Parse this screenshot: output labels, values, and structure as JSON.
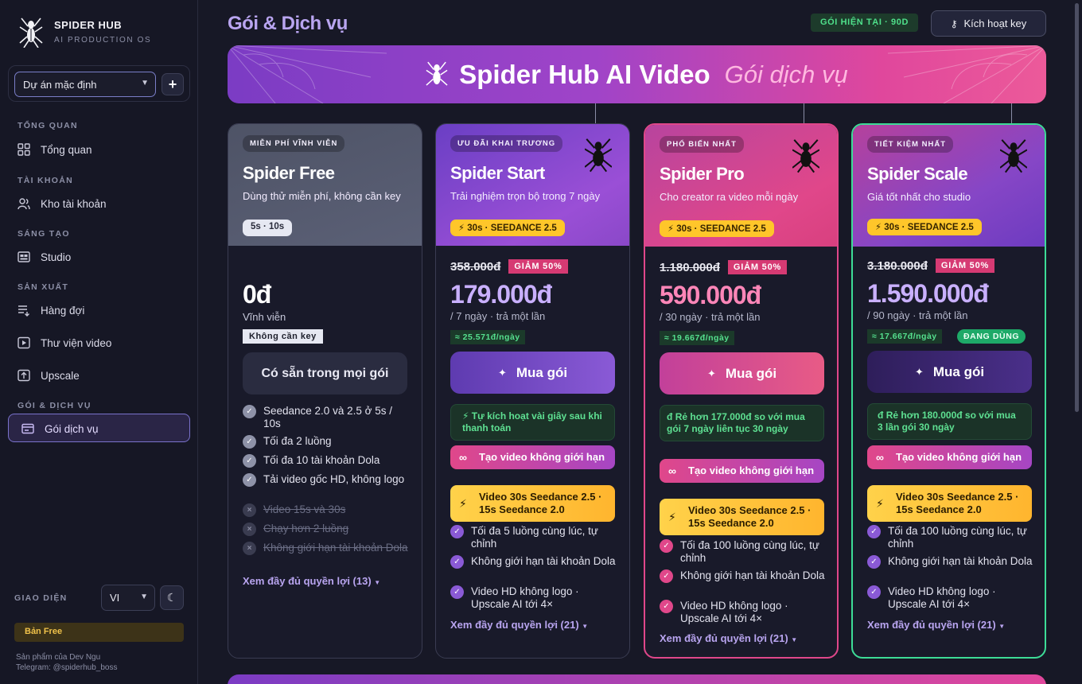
{
  "brand": {
    "name": "SPIDER HUB",
    "sub": "AI PRODUCTION OS"
  },
  "project": {
    "selected": "Dự án mặc định",
    "add": "+"
  },
  "nav": {
    "sections": [
      "TỔNG QUAN",
      "TÀI KHOẢN",
      "SÁNG TẠO",
      "SẢN XUẤT",
      "GÓI & DỊCH VỤ"
    ],
    "items": [
      "Tổng quan",
      "Kho tài khoản",
      "Studio",
      "Hàng đợi",
      "Thư viện video",
      "Upscale",
      "Gói dịch vụ"
    ]
  },
  "footer": {
    "giao_dien": "GIAO DIỆN",
    "lang": "VI",
    "plan_badge": "Bản Free",
    "credit1": "Sản phẩm của Dev Ngu",
    "credit2": "Telegram: @spiderhub_boss"
  },
  "header": {
    "title": "Gói & Dịch vụ",
    "current_plan": "GÓI HIỆN TẠI · 90D",
    "activate": "Kích hoạt key"
  },
  "banner": {
    "title": "Spider Hub AI Video",
    "subtitle": "Gói dịch vụ"
  },
  "colors": {
    "accent": "#b9a5f0",
    "pro": "#e0478a",
    "scale": "#3ddc97"
  },
  "plans": [
    {
      "tag": "MIỄN PHÍ VĨNH VIỄN",
      "name": "Spider Free",
      "desc": "Dùng thử miễn phí, không cần key",
      "chip": "5s · 10s",
      "price": "0đ",
      "per": "Vĩnh viễn",
      "nokey": "Không cần key",
      "avail": "Có sẵn trong mọi gói",
      "list": [
        "Seedance 2.0 và 2.5 ở 5s / 10s",
        "Tối đa 2 luồng",
        "Tối đa 10 tài khoản Dola",
        "Tải video gốc HD, không logo",
        "Video 15s và 30s",
        "Chạy hơn 2 luồng",
        "Không giới hạn tài khoản Dola"
      ],
      "more": "Xem đầy đủ quyền lợi (13)"
    },
    {
      "tag": "ƯU ĐÃI KHAI TRƯƠNG",
      "name": "Spider Start",
      "desc": "Trải nghiệm trọn bộ trong 7 ngày",
      "chip": "30s · SEEDANCE 2.5",
      "old": "358.000đ",
      "disc": "GIẢM 50%",
      "price": "179.000đ",
      "per": "/ 7 ngày · trả một lần",
      "perday": "≈ 25.571đ/ngày",
      "buy": "Mua gói",
      "note": "Tự kích hoạt vài giây sau khi thanh toán",
      "f1": "Tạo video không giới hạn",
      "f2": "Video 30s Seedance 2.5 · 15s Seedance 2.0",
      "list": [
        "Tối đa 5 luồng cùng lúc, tự chỉnh",
        "Không giới hạn tài khoản Dola",
        "Video HD không logo · Upscale AI tới 4×"
      ],
      "more": "Xem đầy đủ quyền lợi (21)"
    },
    {
      "tag": "PHỔ BIẾN NHẤT",
      "name": "Spider Pro",
      "desc": "Cho creator ra video mỗi ngày",
      "chip": "30s · SEEDANCE 2.5",
      "old": "1.180.000đ",
      "disc": "GIẢM 50%",
      "price": "590.000đ",
      "per": "/ 30 ngày · trả một lần",
      "perday": "≈ 19.667đ/ngày",
      "buy": "Mua gói",
      "note": "Rẻ hơn 177.000đ so với mua gói 7 ngày liên tục 30 ngày",
      "f1": "Tạo video không giới hạn",
      "f2": "Video 30s Seedance 2.5 · 15s Seedance 2.0",
      "list": [
        "Tối đa 100 luồng cùng lúc, tự chỉnh",
        "Không giới hạn tài khoản Dola",
        "Video HD không logo · Upscale AI tới 4×"
      ],
      "more": "Xem đầy đủ quyền lợi (21)"
    },
    {
      "tag": "TIẾT KIỆM NHẤT",
      "name": "Spider Scale",
      "desc": "Giá tốt nhất cho studio",
      "chip": "30s · SEEDANCE 2.5",
      "old": "3.180.000đ",
      "disc": "GIẢM 50%",
      "price": "1.590.000đ",
      "per": "/ 90 ngày · trả một lần",
      "perday": "≈ 17.667đ/ngày",
      "using": "ĐANG DÙNG",
      "buy": "Mua gói",
      "note": "Rẻ hơn 180.000đ so với mua 3 lần gói 30 ngày",
      "f1": "Tạo video không giới hạn",
      "f2": "Video 30s Seedance 2.5 · 15s Seedance 2.0",
      "list": [
        "Tối đa 100 luồng cùng lúc, tự chỉnh",
        "Không giới hạn tài khoản Dola",
        "Video HD không logo · Upscale AI tới 4×"
      ],
      "more": "Xem đầy đủ quyền lợi (21)"
    }
  ]
}
